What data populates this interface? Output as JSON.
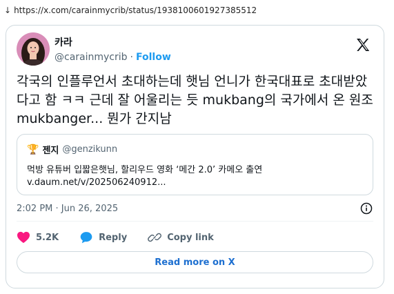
{
  "url": {
    "prefix_icon": "download-arrow-icon",
    "text": "https://x.com/carainmycrib/status/1938100601927385512"
  },
  "author": {
    "name": "카라",
    "handle": "@carainmycrib",
    "separator": "·",
    "follow_label": "Follow"
  },
  "tweet": {
    "text": "각국의 인플루언서 초대하는데 햇님 언니가 한국대표로 초대받았다고 함 ㅋㅋ 근데 잘 어울리는 듯 mukbang의 국가에서 온 원조mukbanger... 뭔가 간지남"
  },
  "quote": {
    "icon": "🏆",
    "name": "젠지",
    "handle": "@genzikunn",
    "line1": "먹방 유튜버 입짧은햇님, 할리우드 영화 ‘메간 2.0’ 카메오 출연",
    "line2": "v.daum.net/v/202506240912..."
  },
  "timestamp": "2:02 PM · Jun 26, 2025",
  "actions": {
    "likes": "5.2K",
    "reply_label": "Reply",
    "copy_label": "Copy link"
  },
  "read_more_label": "Read more on X",
  "colors": {
    "accent": "#1d9bf0",
    "like": "#f91880",
    "border": "#cfd9de",
    "muted": "#536471"
  }
}
